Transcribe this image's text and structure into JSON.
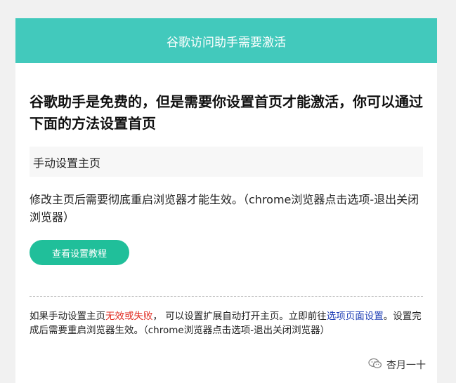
{
  "header": {
    "title": "谷歌访问助手需要激活"
  },
  "main": {
    "headline": "谷歌助手是免费的，但是需要你设置首页才能激活，你可以通过下面的方法设置首页",
    "section_title": "手动设置主页",
    "note": "修改主页后需要彻底重启浏览器才能生效。（chrome浏览器点击选项-退出关闭浏览器）",
    "button_label": "查看设置教程"
  },
  "footer": {
    "part1": "如果手动设置主页",
    "warning": "无效或失败",
    "part2": "， 可以设置扩展自动打开主页。立即前往",
    "link": "选项页面设置",
    "part3": "。设置完成后需要重启浏览器生效。（chrome浏览器点击选项-退出关闭浏览器）"
  },
  "watermark": {
    "text": "杏月一十",
    "icon": "wechat-icon"
  },
  "colors": {
    "header_bg": "#42c9bc",
    "button_bg": "#20bf9a",
    "warning": "#e02b20",
    "link": "#1f3fb5"
  }
}
